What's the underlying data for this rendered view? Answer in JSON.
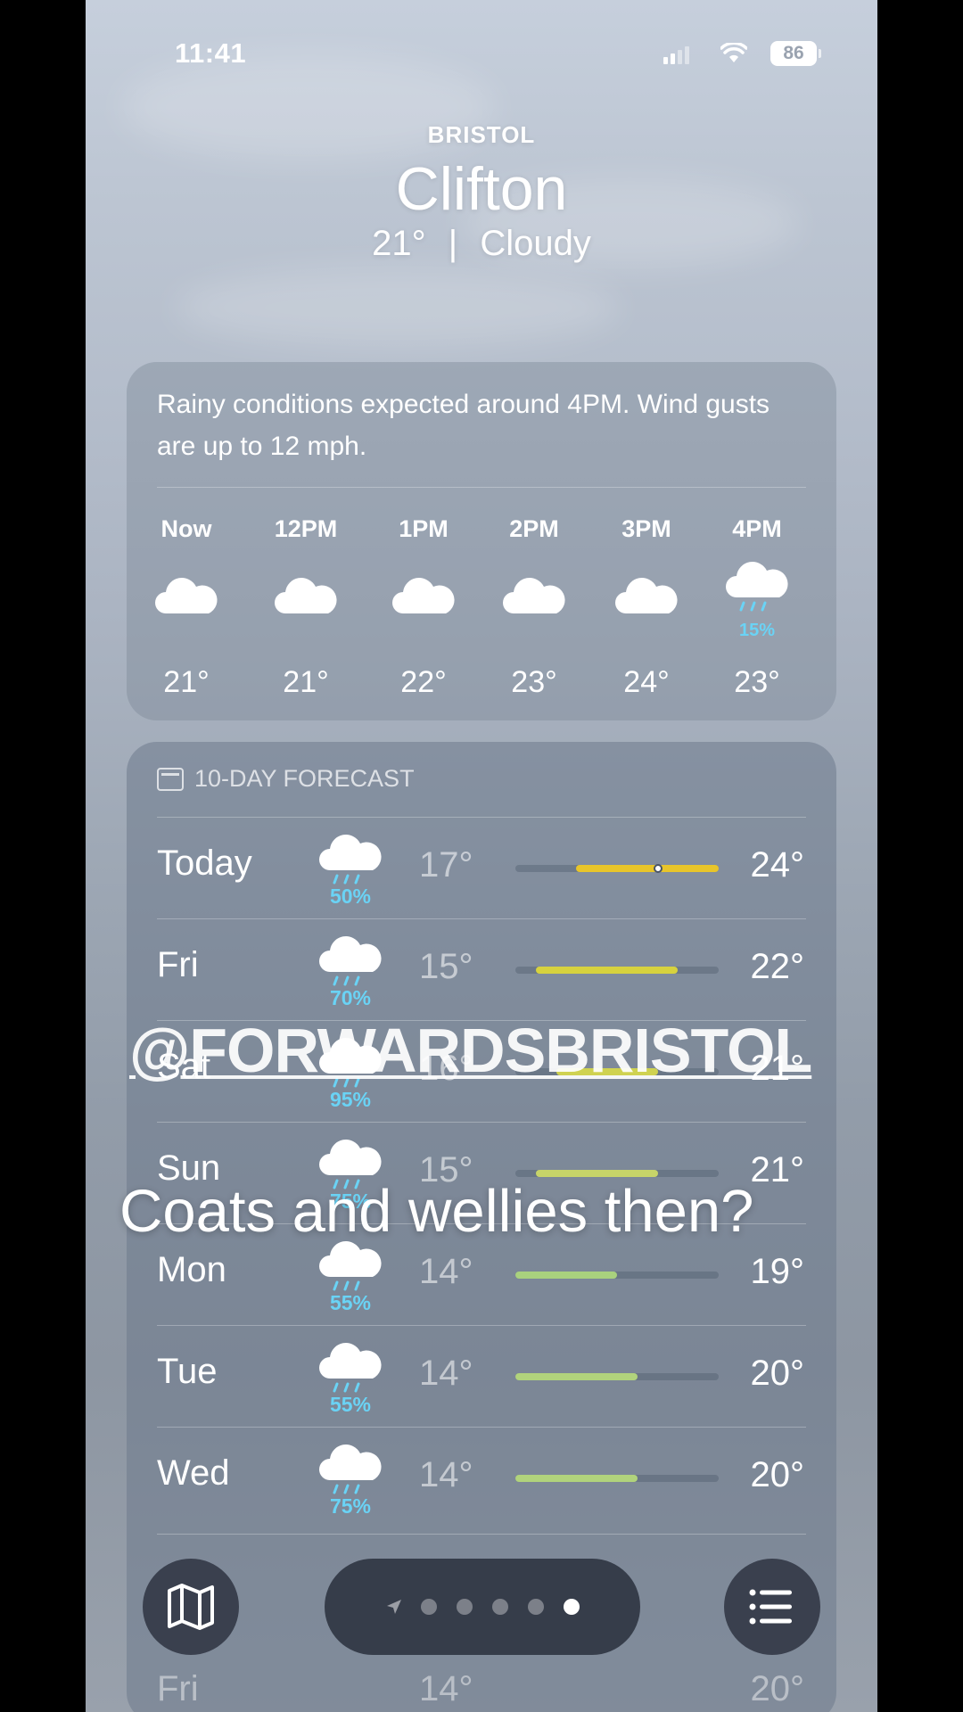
{
  "status_bar": {
    "time": "11:41",
    "battery": "86"
  },
  "header": {
    "region": "BRISTOL",
    "city": "Clifton",
    "current_temp": "21°",
    "separator": "|",
    "condition": "Cloudy"
  },
  "hourly": {
    "description": "Rainy conditions expected around 4PM. Wind gusts are up to 12 mph.",
    "items": [
      {
        "label": "Now",
        "icon": "cloud-icon",
        "temp": "21°",
        "pop": ""
      },
      {
        "label": "12PM",
        "icon": "cloud-icon",
        "temp": "21°",
        "pop": ""
      },
      {
        "label": "1PM",
        "icon": "cloud-icon",
        "temp": "22°",
        "pop": ""
      },
      {
        "label": "2PM",
        "icon": "cloud-icon",
        "temp": "23°",
        "pop": ""
      },
      {
        "label": "3PM",
        "icon": "cloud-icon",
        "temp": "24°",
        "pop": ""
      },
      {
        "label": "4PM",
        "icon": "cloud-rain-icon",
        "temp": "23°",
        "pop": "15%"
      }
    ]
  },
  "daily": {
    "title": "10-DAY FORECAST",
    "items": [
      {
        "day": "Today",
        "pop": "50%",
        "low": "17°",
        "high": "24°",
        "range": [
          17,
          24
        ],
        "current": 21,
        "color": "#e8c52a"
      },
      {
        "day": "Fri",
        "pop": "70%",
        "low": "15°",
        "high": "22°",
        "range": [
          15,
          22
        ],
        "color": "#d7d23e"
      },
      {
        "day": "Sat",
        "pop": "95%",
        "low": "16°",
        "high": "21°",
        "range": [
          16,
          21
        ],
        "color": "#cfd251"
      },
      {
        "day": "Sun",
        "pop": "75%",
        "low": "15°",
        "high": "21°",
        "range": [
          15,
          21
        ],
        "color": "#c7d469"
      },
      {
        "day": "Mon",
        "pop": "55%",
        "low": "14°",
        "high": "19°",
        "range": [
          14,
          19
        ],
        "color": "#a9d17e"
      },
      {
        "day": "Tue",
        "pop": "55%",
        "low": "14°",
        "high": "20°",
        "range": [
          14,
          20
        ],
        "color": "#b1d37c"
      },
      {
        "day": "Wed",
        "pop": "75%",
        "low": "14°",
        "high": "20°",
        "range": [
          14,
          20
        ],
        "color": "#b1d37c"
      }
    ],
    "scale": [
      14,
      24
    ],
    "ghost_next": {
      "day": "Fri",
      "low": "14°",
      "high": "20°"
    }
  },
  "overlay": {
    "handle": "@FORWARDSBRISTOL",
    "caption": "Coats and wellies then?"
  },
  "toolbar": {
    "map_icon": "map-icon",
    "list_icon": "list-icon",
    "page_count": 5,
    "active_page": 5
  }
}
